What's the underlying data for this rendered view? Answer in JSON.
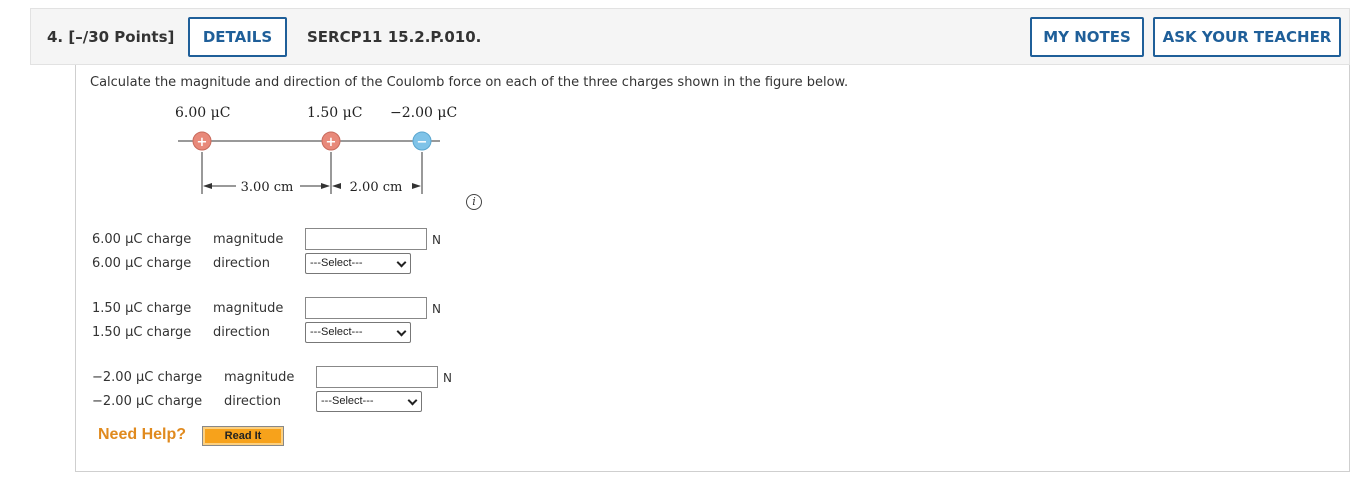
{
  "header": {
    "question_number": "4. [–/30 Points]",
    "details_button": "DETAILS",
    "question_code": "SERCP11 15.2.P.010.",
    "my_notes_button": "MY NOTES",
    "ask_teacher_button": "ASK YOUR TEACHER"
  },
  "prompt": "Calculate the magnitude and direction of the Coulomb force on each of the three charges shown in the figure below.",
  "figure": {
    "charges": [
      {
        "label": "6.00 μC",
        "sign": "+"
      },
      {
        "label": "1.50 μC",
        "sign": "+"
      },
      {
        "label": "−2.00 μC",
        "sign": "−"
      }
    ],
    "distances": [
      "3.00 cm",
      "2.00 cm"
    ],
    "info_icon": "i"
  },
  "rows": [
    {
      "charge": "6.00 μC charge",
      "field": "magnitude",
      "type": "input",
      "value": "",
      "unit": "N"
    },
    {
      "charge": "6.00 μC charge",
      "field": "direction",
      "type": "select",
      "selected": "---Select---"
    },
    {
      "charge": "1.50 μC charge",
      "field": "magnitude",
      "type": "input",
      "value": "",
      "unit": "N"
    },
    {
      "charge": "1.50 μC charge",
      "field": "direction",
      "type": "select",
      "selected": "---Select---"
    },
    {
      "charge": "−2.00 μC charge",
      "field": "magnitude",
      "type": "input",
      "value": "",
      "unit": "N"
    },
    {
      "charge": "−2.00 μC charge",
      "field": "direction",
      "type": "select",
      "selected": "---Select---"
    }
  ],
  "help": {
    "need_help": "Need Help?",
    "read_it": "Read It"
  },
  "colors": {
    "button_blue": "#1f5f99",
    "positive_charge": "#e8897a",
    "negative_charge": "#7fc3e8",
    "help_orange": "#e08a1e"
  }
}
